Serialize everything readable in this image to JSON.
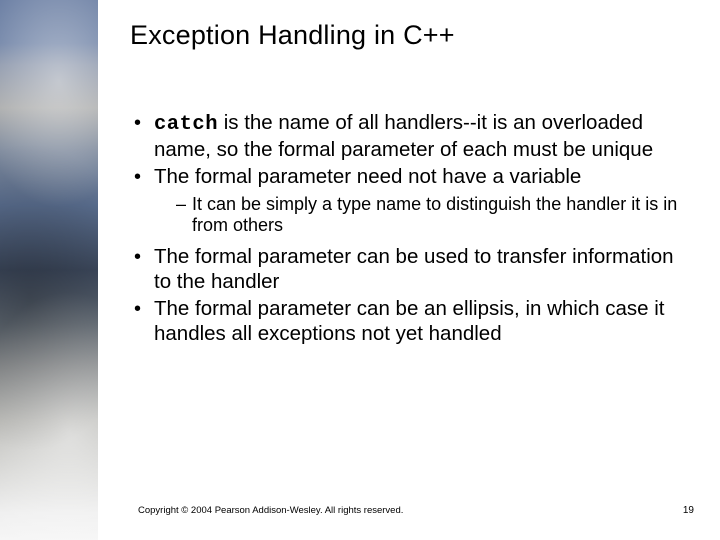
{
  "title": "Exception Handling in C++",
  "bullets": {
    "b1": {
      "code": "catch",
      "rest": " is the name of all handlers--it is an overloaded name, so the formal parameter of each must be unique"
    },
    "b2": "The formal parameter need not have a variable",
    "b2sub1": "It can be simply a type name to distinguish the handler it is in from others",
    "b3": "The formal parameter can be used to transfer information to the handler",
    "b4": "The formal parameter can be an ellipsis, in which case it handles all exceptions not yet handled"
  },
  "footer": "Copyright © 2004 Pearson Addison-Wesley. All rights reserved.",
  "page": "19"
}
